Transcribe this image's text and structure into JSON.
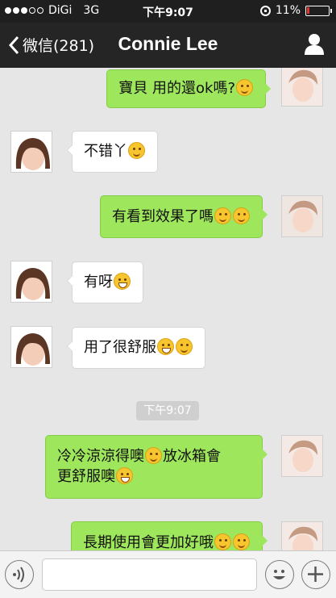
{
  "status_bar": {
    "carrier": "DiGi",
    "network": "3G",
    "time": "下午9:07",
    "battery": "11%",
    "battery_level": 0.11
  },
  "nav": {
    "back_label": "微信(281)",
    "title": "Connie Lee"
  },
  "messages": [
    {
      "side": "out",
      "text": "寶貝 用的還ok嗎?",
      "emojis": [
        "blush"
      ]
    },
    {
      "side": "in",
      "text": "不错丫",
      "emojis": [
        "smile"
      ]
    },
    {
      "side": "out",
      "text": "有看到效果了嗎",
      "emojis": [
        "smirk",
        "smirk"
      ]
    },
    {
      "side": "in",
      "text": "有呀",
      "emojis": [
        "grin"
      ]
    },
    {
      "side": "in",
      "text": "用了很舒服",
      "emojis": [
        "grin",
        "smirk"
      ]
    },
    {
      "side": "out",
      "text_line1": "冷冷涼涼得噢",
      "text_line1_after": "放冰箱會",
      "text_line2": "更舒服噢",
      "emojis": [
        "smirk",
        "grin"
      ]
    },
    {
      "side": "out",
      "text": "長期使用會更加好哦",
      "emojis": [
        "blush",
        "blush"
      ]
    }
  ],
  "timestamp": "下午9:07",
  "colors": {
    "outgoing_bubble": "#9ee65c",
    "incoming_bubble": "#ffffff",
    "nav_background": "#252525",
    "chat_background": "#e6e6e6"
  },
  "icons": {
    "back": "chevron-left-icon",
    "profile": "person-icon",
    "voice": "voice-icon",
    "emoji": "emoji-icon",
    "add": "plus-icon"
  }
}
